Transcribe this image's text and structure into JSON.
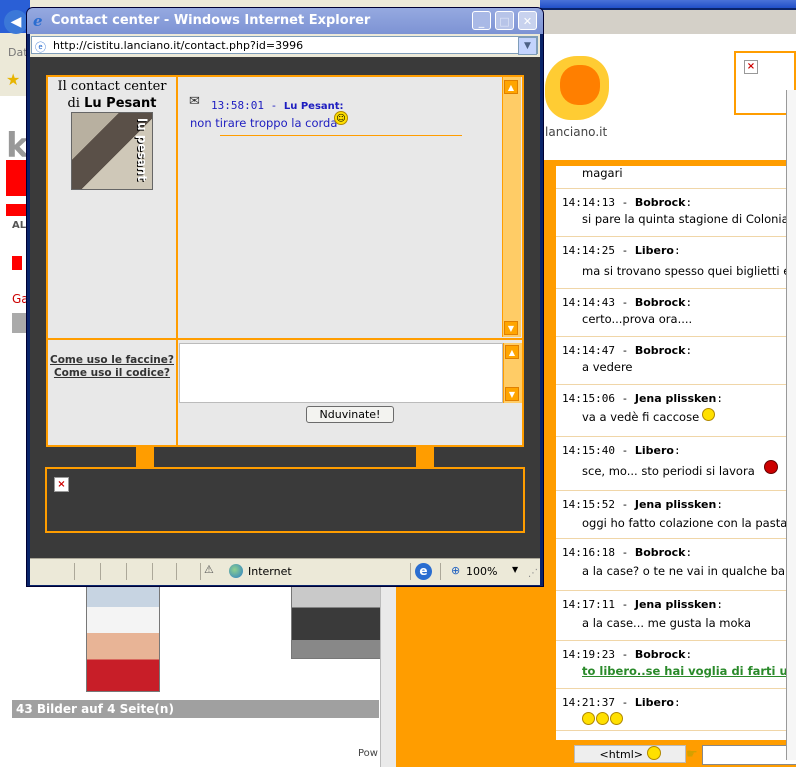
{
  "popup": {
    "title": "Contact center - Windows Internet Explorer",
    "url": "http://cistitu.lanciano.it/contact.php?id=3996",
    "heading_line1": "Il contact center",
    "heading_di": "di",
    "contact_name": "Lu Pesant",
    "avatar_text": "lu pesant",
    "message": {
      "time": "13:58:01 -",
      "author": "Lu Pesant:",
      "text": "non tirare troppo la corda"
    },
    "help_link_faces": "Come uso le faccine?",
    "help_link_code": "Come uso il codice?",
    "send_button": "Nduvinate!",
    "status_zone": "Internet",
    "status_zoom": "100%"
  },
  "background_right": {
    "domain": "lanciano.it",
    "chat": [
      {
        "time": "",
        "author": "",
        "text": "magari"
      },
      {
        "time": "14:14:13",
        "author": "Bobrock",
        "text": "si pare la quinta stagione di Colonia"
      },
      {
        "time": "14:14:25",
        "author": "Libero",
        "text": "ma si trovano spesso quei biglietti e"
      },
      {
        "time": "14:14:43",
        "author": "Bobrock",
        "text": "certo...prova ora...."
      },
      {
        "time": "14:14:47",
        "author": "Bobrock",
        "text": "a vedere"
      },
      {
        "time": "14:15:06",
        "author": "Jena plissken",
        "text": "va a vedè fi caccose"
      },
      {
        "time": "14:15:40",
        "author": "Libero",
        "text": "sce, mo... sto periodi si lavora"
      },
      {
        "time": "14:15:52",
        "author": "Jena plissken",
        "text": "oggi ho fatto colazione con la pasta"
      },
      {
        "time": "14:16:18",
        "author": "Bobrock",
        "text": "a la case? o te ne vai in qualche ba"
      },
      {
        "time": "14:17:11",
        "author": "Jena plissken",
        "text": "a la case... me gusta la moka"
      },
      {
        "time": "14:19:23",
        "author": "Bobrock",
        "text": "to libero..se hai voglia di farti u"
      },
      {
        "time": "14:21:37",
        "author": "Libero",
        "text": ""
      }
    ],
    "html_button": "<html>"
  },
  "background_left": {
    "address_label": "Dat",
    "gallery_label": "Ga",
    "footer": "43 Bilder auf 4 Seite(n)",
    "powered": "Pow",
    "left_k": "k",
    "red_label": "AL"
  }
}
